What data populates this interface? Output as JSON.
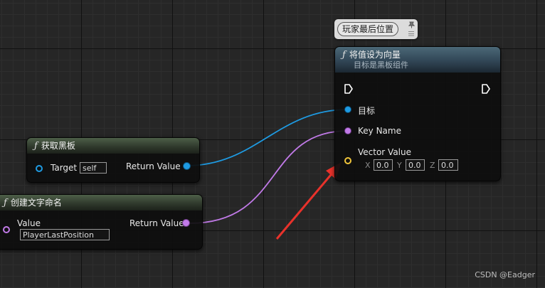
{
  "comment": {
    "text": "玩家最后位置"
  },
  "set_node": {
    "title": "将值设为向量",
    "subtitle": "目标是黑板组件",
    "pins": {
      "target_label": "目标",
      "key_label": "Key Name",
      "vector_label": "Vector Value"
    },
    "vector": {
      "x_label": "X",
      "x_value": "0.0",
      "y_label": "Y",
      "y_value": "0.0",
      "z_label": "Z",
      "z_value": "0.0"
    }
  },
  "blackboard_node": {
    "title": "获取黑板",
    "target_label": "Target",
    "target_value": "self",
    "return_label": "Return Value"
  },
  "name_node": {
    "title": "创建文字命名",
    "value_label": "Value",
    "value_text": "PlayerLastPosition",
    "return_label": "Return Value"
  },
  "watermark": "CSDN @Eadger",
  "colors": {
    "object_pin": "#1e9be3",
    "name_pin": "#c17ae8",
    "vector_pin": "#f0c53a",
    "arrow": "#e8322b",
    "function_header_blue": "#314656",
    "function_header_green": "#303a2d"
  },
  "icons": {
    "function": "function-icon",
    "exec": "exec-pin-icon",
    "comment_handle": "pin-icon"
  }
}
